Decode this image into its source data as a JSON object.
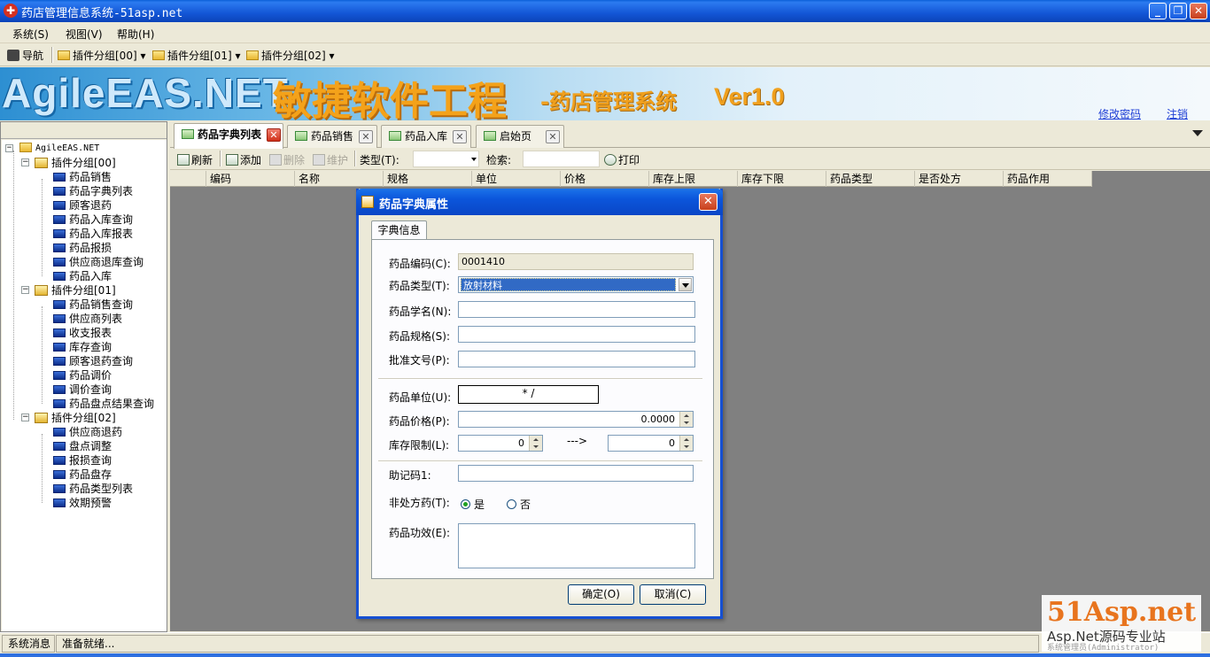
{
  "window": {
    "title": "药店管理信息系统-51asp.net"
  },
  "menubar": {
    "items": [
      "系统(S)",
      "视图(V)",
      "帮助(H)"
    ]
  },
  "pluginbar": {
    "nav": "导航",
    "groups": [
      "插件分组[00]",
      "插件分组[01]",
      "插件分组[02]"
    ]
  },
  "banner": {
    "brand": "AgileEAS.NET",
    "cn": "敏捷软件工程",
    "sub": "-药店管理系统",
    "version": "Ver1.0",
    "change_password": "修改密码",
    "logout": "注销"
  },
  "tree": {
    "root": "AgileEAS.NET",
    "groups": [
      {
        "label": "插件分组[00]",
        "items": [
          "药品销售",
          "药品字典列表",
          "顾客退药",
          "药品入库查询",
          "药品入库报表",
          "药品报损",
          "供应商退库查询",
          "药品入库"
        ]
      },
      {
        "label": "插件分组[01]",
        "items": [
          "药品销售查询",
          "供应商列表",
          "收支报表",
          "库存查询",
          "顾客退药查询",
          "药品调价",
          "调价查询",
          "药品盘点结果查询"
        ]
      },
      {
        "label": "插件分组[02]",
        "items": [
          "供应商退药",
          "盘点调整",
          "报损查询",
          "药品盘存",
          "药品类型列表",
          "效期预警"
        ]
      }
    ]
  },
  "tabs": [
    {
      "label": "药品字典列表",
      "active": true
    },
    {
      "label": "药品销售",
      "active": false
    },
    {
      "label": "药品入库",
      "active": false
    },
    {
      "label": "启始页",
      "active": false
    }
  ],
  "gridbar": {
    "refresh": "刷新",
    "add": "添加",
    "delete": "删除",
    "edit": "维护",
    "type_label": "类型(T):",
    "search_label": "检索:",
    "print": "打印"
  },
  "grid": {
    "columns": [
      "编码",
      "名称",
      "规格",
      "单位",
      "价格",
      "库存上限",
      "库存下限",
      "药品类型",
      "是否处方",
      "药品作用"
    ]
  },
  "dialog": {
    "title": "药品字典属性",
    "tab": "字典信息",
    "code_label": "药品编码(C):",
    "code_value": "0001410",
    "type_label": "药品类型(T):",
    "type_value": "放射材料",
    "name_label": "药品学名(N):",
    "name_value": "",
    "spec_label": "药品规格(S):",
    "spec_value": "",
    "approval_label": "批准文号(P):",
    "approval_value": "",
    "unit_label": "药品单位(U):",
    "unit_value": "*          /",
    "price_label": "药品价格(P):",
    "price_value": "0.0000",
    "stock_label": "库存限制(L):",
    "stock_min": "0",
    "stock_arrow": "--->",
    "stock_max": "0",
    "mnemonic_label": "助记码1:",
    "mnemonic_value": "",
    "otc_label": "非处方药(T):",
    "otc_yes": "是",
    "otc_no": "否",
    "effect_label": "药品功效(E):",
    "effect_value": "",
    "ok": "确定(O)",
    "cancel": "取消(C)"
  },
  "statusbar": {
    "label": "系统消息",
    "message": "准备就绪..."
  },
  "watermark": {
    "site": "51Asp.net",
    "slogan": "Asp.Net源码专业站",
    "sub": "系统管理员(Administrator)"
  }
}
